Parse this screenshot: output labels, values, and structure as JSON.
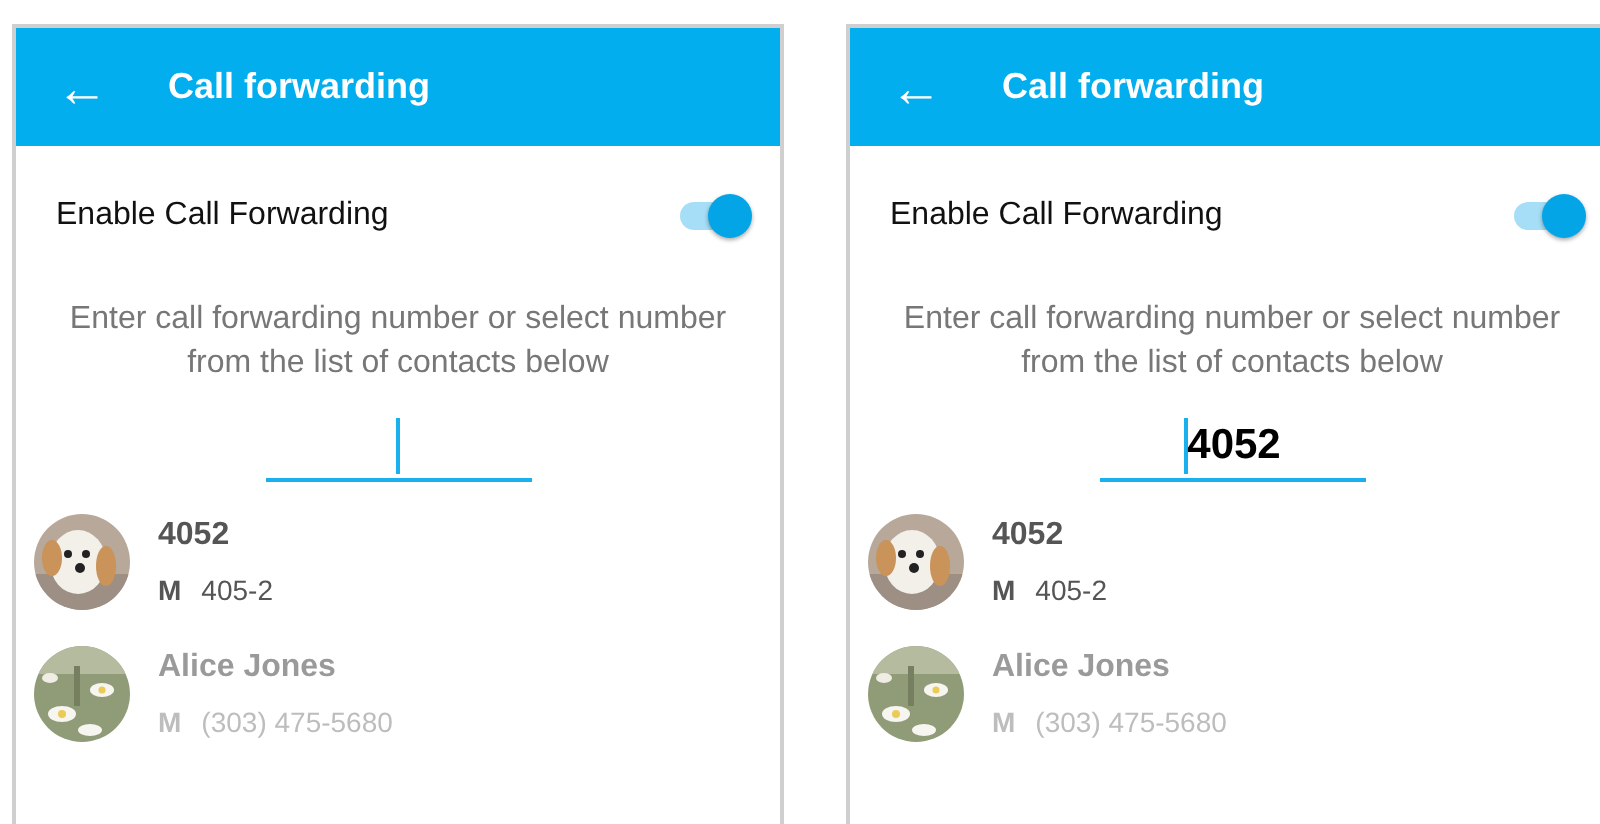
{
  "screens": [
    {
      "app_bar": {
        "back": "←",
        "title": "Call forwarding"
      },
      "toggle": {
        "label": "Enable Call Forwarding",
        "on": true
      },
      "helper_text": "Enter call forwarding number or select number from the list of contacts below",
      "number_field": {
        "focused": true
      },
      "contacts": [
        {
          "name": "4052",
          "phone_type": "M",
          "phone": "405-2",
          "disabled": false
        },
        {
          "name": "Alice Jones",
          "phone_type": "M",
          "phone": "(303) 475-5680",
          "disabled": true
        }
      ]
    },
    {
      "app_bar": {
        "back": "←",
        "title": "Call forwarding"
      },
      "toggle": {
        "label": "Enable Call Forwarding",
        "on": true
      },
      "helper_text": "Enter call forwarding number or select number from the list of contacts below",
      "number_field": {
        "value": "4052",
        "focused": true
      },
      "contacts": [
        {
          "name": "4052",
          "phone_type": "M",
          "phone": "405-2",
          "disabled": false
        },
        {
          "name": "Alice Jones",
          "phone_type": "M",
          "phone": "(303) 475-5680",
          "disabled": true
        }
      ]
    }
  ]
}
